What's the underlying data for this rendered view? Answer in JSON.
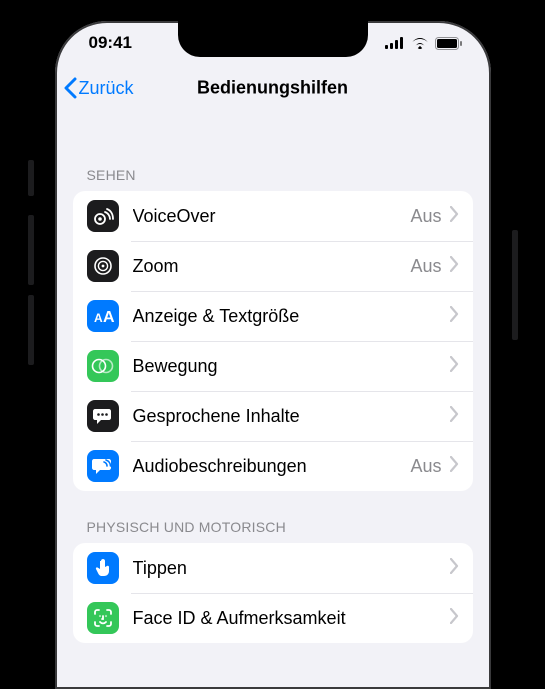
{
  "status": {
    "time": "09:41"
  },
  "nav": {
    "back": "Zurück",
    "title": "Bedienungshilfen"
  },
  "sections": [
    {
      "header": "Sehen",
      "rows": [
        {
          "icon": "voiceover",
          "label": "VoiceOver",
          "value": "Aus"
        },
        {
          "icon": "zoom",
          "label": "Zoom",
          "value": "Aus"
        },
        {
          "icon": "textsize",
          "label": "Anzeige & Textgröße",
          "value": ""
        },
        {
          "icon": "motion",
          "label": "Bewegung",
          "value": ""
        },
        {
          "icon": "speech",
          "label": "Gesprochene Inhalte",
          "value": ""
        },
        {
          "icon": "audiodesc",
          "label": "Audiobeschreibungen",
          "value": "Aus"
        }
      ]
    },
    {
      "header": "Physisch und motorisch",
      "rows": [
        {
          "icon": "touch",
          "label": "Tippen",
          "value": ""
        },
        {
          "icon": "faceid",
          "label": "Face ID & Aufmerksamkeit",
          "value": ""
        }
      ]
    }
  ],
  "colors": {
    "voiceover": "#1c1c1e",
    "zoom": "#1c1c1e",
    "textsize": "#007aff",
    "motion": "#34c759",
    "speech": "#1c1c1e",
    "audiodesc": "#007aff",
    "touch": "#007aff",
    "faceid": "#34c759"
  }
}
